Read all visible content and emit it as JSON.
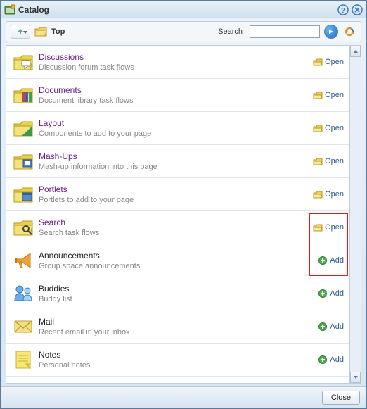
{
  "window": {
    "title": "Catalog"
  },
  "toolbar": {
    "breadcrumb": "Top",
    "search_label": "Search",
    "search_value": ""
  },
  "rows": [
    {
      "title": "Discussions",
      "desc": "Discussion forum task flows",
      "action": "open",
      "action_label": "Open",
      "title_link": true,
      "icon": "folder-discuss"
    },
    {
      "title": "Documents",
      "desc": "Document library task flows",
      "action": "open",
      "action_label": "Open",
      "title_link": true,
      "icon": "folder-docs"
    },
    {
      "title": "Layout",
      "desc": "Components to add to your page",
      "action": "open",
      "action_label": "Open",
      "title_link": true,
      "icon": "folder-layout"
    },
    {
      "title": "Mash-Ups",
      "desc": "Mash-up information into this page",
      "action": "open",
      "action_label": "Open",
      "title_link": true,
      "icon": "folder-mashup"
    },
    {
      "title": "Portlets",
      "desc": "Portlets to add to your page",
      "action": "open",
      "action_label": "Open",
      "title_link": true,
      "icon": "folder-portlet"
    },
    {
      "title": "Search",
      "desc": "Search task flows",
      "action": "open",
      "action_label": "Open",
      "title_link": true,
      "icon": "folder-search"
    },
    {
      "title": "Announcements",
      "desc": "Group space announcements",
      "action": "add",
      "action_label": "Add",
      "title_link": false,
      "icon": "megaphone"
    },
    {
      "title": "Buddies",
      "desc": "Buddy list",
      "action": "add",
      "action_label": "Add",
      "title_link": false,
      "icon": "buddies"
    },
    {
      "title": "Mail",
      "desc": "Recent email in your inbox",
      "action": "add",
      "action_label": "Add",
      "title_link": false,
      "icon": "mail"
    },
    {
      "title": "Notes",
      "desc": "Personal notes",
      "action": "add",
      "action_label": "Add",
      "title_link": false,
      "icon": "notes"
    }
  ],
  "footer": {
    "close_label": "Close"
  },
  "highlight": {
    "row_start": 5,
    "row_end": 6
  }
}
